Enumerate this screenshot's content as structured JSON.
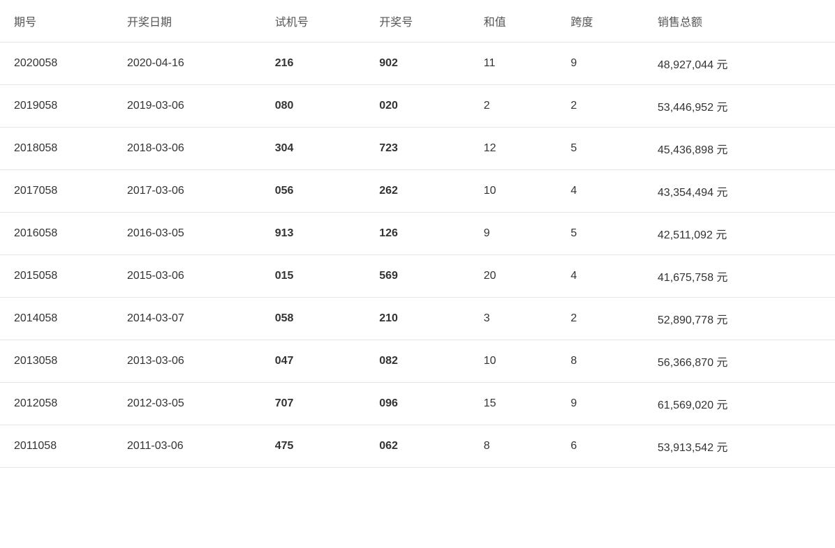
{
  "table": {
    "headers": [
      "期号",
      "开奖日期",
      "试机号",
      "开奖号",
      "和值",
      "跨度",
      "销售总额"
    ],
    "rows": [
      {
        "period": "2020058",
        "date": "2020-04-16",
        "trial": "216",
        "win": "902",
        "sum": "11",
        "span": "9",
        "sales": "48,927,044 元"
      },
      {
        "period": "2019058",
        "date": "2019-03-06",
        "trial": "080",
        "win": "020",
        "sum": "2",
        "span": "2",
        "sales": "53,446,952 元"
      },
      {
        "period": "2018058",
        "date": "2018-03-06",
        "trial": "304",
        "win": "723",
        "sum": "12",
        "span": "5",
        "sales": "45,436,898 元"
      },
      {
        "period": "2017058",
        "date": "2017-03-06",
        "trial": "056",
        "win": "262",
        "sum": "10",
        "span": "4",
        "sales": "43,354,494 元"
      },
      {
        "period": "2016058",
        "date": "2016-03-05",
        "trial": "913",
        "win": "126",
        "sum": "9",
        "span": "5",
        "sales": "42,511,092 元"
      },
      {
        "period": "2015058",
        "date": "2015-03-06",
        "trial": "015",
        "win": "569",
        "sum": "20",
        "span": "4",
        "sales": "41,675,758 元"
      },
      {
        "period": "2014058",
        "date": "2014-03-07",
        "trial": "058",
        "win": "210",
        "sum": "3",
        "span": "2",
        "sales": "52,890,778 元"
      },
      {
        "period": "2013058",
        "date": "2013-03-06",
        "trial": "047",
        "win": "082",
        "sum": "10",
        "span": "8",
        "sales": "56,366,870 元"
      },
      {
        "period": "2012058",
        "date": "2012-03-05",
        "trial": "707",
        "win": "096",
        "sum": "15",
        "span": "9",
        "sales": "61,569,020 元"
      },
      {
        "period": "2011058",
        "date": "2011-03-06",
        "trial": "475",
        "win": "062",
        "sum": "8",
        "span": "6",
        "sales": "53,913,542 元"
      }
    ]
  }
}
